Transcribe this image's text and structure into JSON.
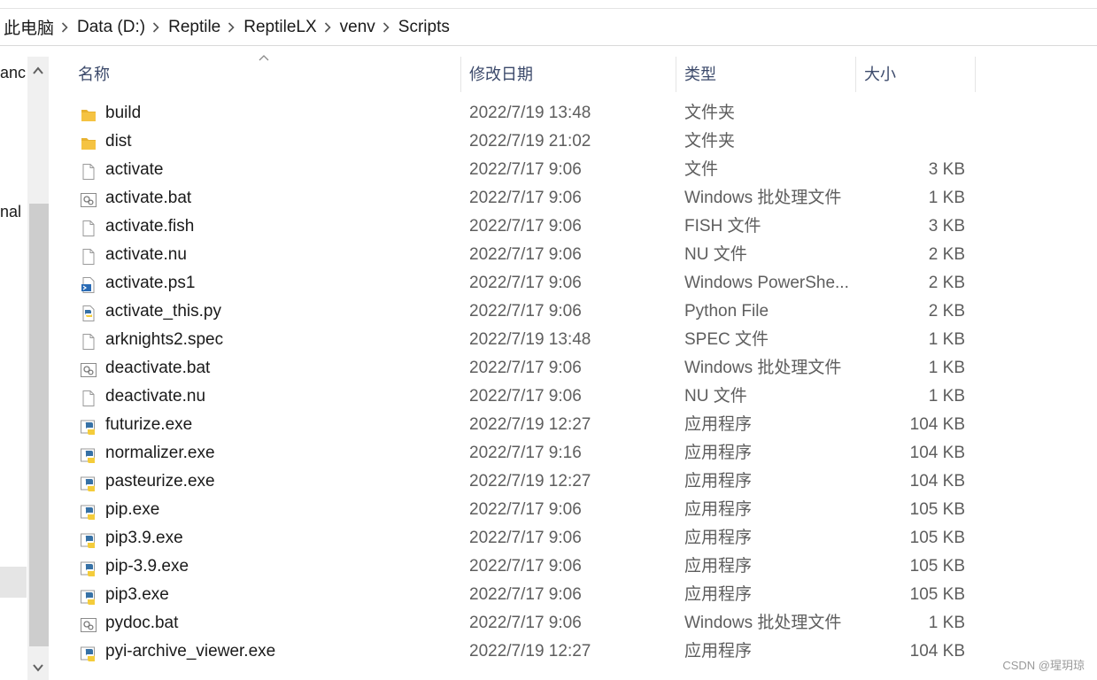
{
  "breadcrumb": [
    "此电脑",
    "Data (D:)",
    "Reptile",
    "ReptileLX",
    "venv",
    "Scripts"
  ],
  "nav": {
    "items": [
      "anc",
      "nal"
    ]
  },
  "columns": {
    "name": "名称",
    "date": "修改日期",
    "type": "类型",
    "size": "大小"
  },
  "files": [
    {
      "name": "build",
      "date": "2022/7/19 13:48",
      "type": "文件夹",
      "size": "",
      "icon": "folder-icon"
    },
    {
      "name": "dist",
      "date": "2022/7/19 21:02",
      "type": "文件夹",
      "size": "",
      "icon": "folder-icon"
    },
    {
      "name": "activate",
      "date": "2022/7/17 9:06",
      "type": "文件",
      "size": "3 KB",
      "icon": "file-icon"
    },
    {
      "name": "activate.bat",
      "date": "2022/7/17 9:06",
      "type": "Windows 批处理文件",
      "size": "1 KB",
      "icon": "batch-file-icon"
    },
    {
      "name": "activate.fish",
      "date": "2022/7/17 9:06",
      "type": "FISH 文件",
      "size": "3 KB",
      "icon": "file-icon"
    },
    {
      "name": "activate.nu",
      "date": "2022/7/17 9:06",
      "type": "NU 文件",
      "size": "2 KB",
      "icon": "file-icon"
    },
    {
      "name": "activate.ps1",
      "date": "2022/7/17 9:06",
      "type": "Windows PowerShe...",
      "size": "2 KB",
      "icon": "powershell-file-icon"
    },
    {
      "name": "activate_this.py",
      "date": "2022/7/17 9:06",
      "type": "Python File",
      "size": "2 KB",
      "icon": "python-file-icon"
    },
    {
      "name": "arknights2.spec",
      "date": "2022/7/19 13:48",
      "type": "SPEC 文件",
      "size": "1 KB",
      "icon": "file-icon"
    },
    {
      "name": "deactivate.bat",
      "date": "2022/7/17 9:06",
      "type": "Windows 批处理文件",
      "size": "1 KB",
      "icon": "batch-file-icon"
    },
    {
      "name": "deactivate.nu",
      "date": "2022/7/17 9:06",
      "type": "NU 文件",
      "size": "1 KB",
      "icon": "file-icon"
    },
    {
      "name": "futurize.exe",
      "date": "2022/7/19 12:27",
      "type": "应用程序",
      "size": "104 KB",
      "icon": "python-exe-icon"
    },
    {
      "name": "normalizer.exe",
      "date": "2022/7/17 9:16",
      "type": "应用程序",
      "size": "104 KB",
      "icon": "python-exe-icon"
    },
    {
      "name": "pasteurize.exe",
      "date": "2022/7/19 12:27",
      "type": "应用程序",
      "size": "104 KB",
      "icon": "python-exe-icon"
    },
    {
      "name": "pip.exe",
      "date": "2022/7/17 9:06",
      "type": "应用程序",
      "size": "105 KB",
      "icon": "python-exe-icon"
    },
    {
      "name": "pip3.9.exe",
      "date": "2022/7/17 9:06",
      "type": "应用程序",
      "size": "105 KB",
      "icon": "python-exe-icon"
    },
    {
      "name": "pip-3.9.exe",
      "date": "2022/7/17 9:06",
      "type": "应用程序",
      "size": "105 KB",
      "icon": "python-exe-icon"
    },
    {
      "name": "pip3.exe",
      "date": "2022/7/17 9:06",
      "type": "应用程序",
      "size": "105 KB",
      "icon": "python-exe-icon"
    },
    {
      "name": "pydoc.bat",
      "date": "2022/7/17 9:06",
      "type": "Windows 批处理文件",
      "size": "1 KB",
      "icon": "batch-file-icon"
    },
    {
      "name": "pyi-archive_viewer.exe",
      "date": "2022/7/19 12:27",
      "type": "应用程序",
      "size": "104 KB",
      "icon": "python-exe-icon"
    }
  ],
  "watermark": "CSDN @瑆玥琼",
  "colors": {
    "header_text": "#3c4a6b",
    "folder": "#f5c342",
    "python_blue": "#3671a6",
    "python_yellow": "#f4cc3b"
  }
}
